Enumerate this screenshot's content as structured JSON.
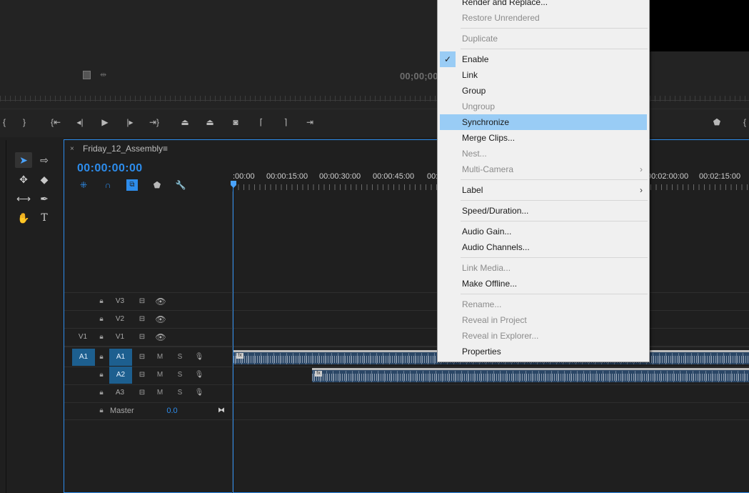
{
  "program_monitor": {
    "timecode": "00;00;00"
  },
  "sequence": {
    "name": "Friday_12_Assembly",
    "close_glyph": "×",
    "menu_glyph": "≡",
    "timecode": "00:00:00:00"
  },
  "ruler": {
    "labels": [
      ":00:00",
      "00:00:15:00",
      "00:00:30:00",
      "00:00:45:00",
      "00:",
      "00:02:00:00",
      "00:02:15:00"
    ]
  },
  "tracks": {
    "v3": {
      "label": "V3"
    },
    "v2": {
      "label": "V2"
    },
    "v1": {
      "source": "V1",
      "label": "V1"
    },
    "a1": {
      "source": "A1",
      "label": "A1",
      "mute": "M",
      "solo": "S"
    },
    "a2": {
      "label": "A2",
      "mute": "M",
      "solo": "S"
    },
    "a3": {
      "label": "A3",
      "mute": "M",
      "solo": "S"
    },
    "master": {
      "label": "Master",
      "value": "0.0"
    }
  },
  "clips": {
    "fx_badge": "fx"
  },
  "context_menu": {
    "items": [
      {
        "label": "Render and Replace...",
        "enabled": true
      },
      {
        "label": "Restore Unrendered",
        "enabled": false
      },
      {
        "label": "Duplicate",
        "enabled": false
      },
      {
        "label": "Enable",
        "enabled": true,
        "checked": true
      },
      {
        "label": "Link",
        "enabled": true
      },
      {
        "label": "Group",
        "enabled": true
      },
      {
        "label": "Ungroup",
        "enabled": false
      },
      {
        "label": "Synchronize",
        "enabled": true,
        "highlighted": true
      },
      {
        "label": "Merge Clips...",
        "enabled": true
      },
      {
        "label": "Nest...",
        "enabled": false
      },
      {
        "label": "Multi-Camera",
        "enabled": false,
        "submenu": true
      },
      {
        "label": "Label",
        "enabled": true,
        "submenu": true
      },
      {
        "label": "Speed/Duration...",
        "enabled": true
      },
      {
        "label": "Audio Gain...",
        "enabled": true
      },
      {
        "label": "Audio Channels...",
        "enabled": true
      },
      {
        "label": "Link Media...",
        "enabled": false
      },
      {
        "label": "Make Offline...",
        "enabled": true
      },
      {
        "label": "Rename...",
        "enabled": false
      },
      {
        "label": "Reveal in Project",
        "enabled": false
      },
      {
        "label": "Reveal in Explorer...",
        "enabled": false
      },
      {
        "label": "Properties",
        "enabled": true
      }
    ],
    "check_glyph": "✓",
    "submenu_glyph": "›"
  },
  "colors": {
    "accent": "#2d8ceb",
    "menu_highlight": "#99ccf5",
    "clip_fill": "#2b4766",
    "target_fill": "#1d5f8f"
  }
}
